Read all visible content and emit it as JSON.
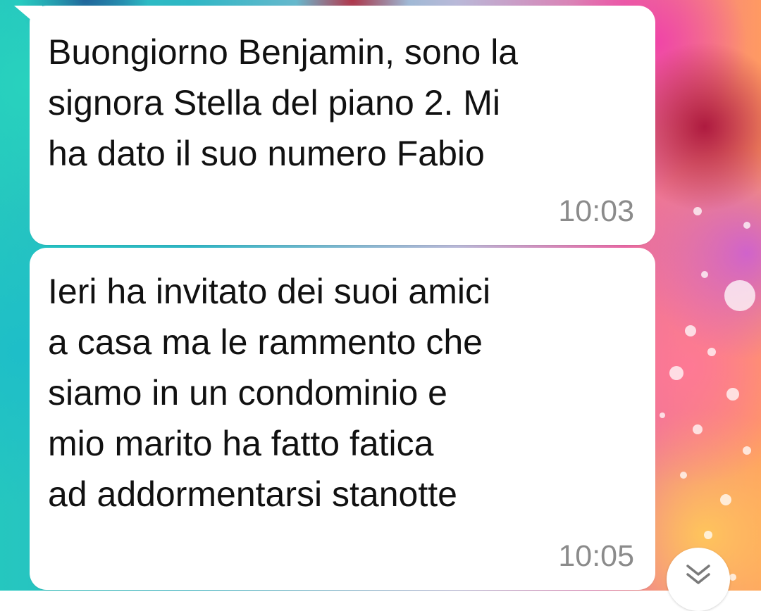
{
  "chat": {
    "messages": [
      {
        "text": "Buongiorno Benjamin, sono la\nsignora Stella del piano 2. Mi\nha dato il suo numero Fabio",
        "time": "10:03"
      },
      {
        "text": "Ieri ha invitato dei suoi amici\na casa ma le rammento che\nsiamo in un condominio e\nmio marito ha fatto fatica\nad addormentarsi stanotte",
        "time": "10:05"
      }
    ]
  },
  "controls": {
    "scroll_down_icon": "double-chevron-down-icon"
  },
  "colors": {
    "bubble_bg": "#ffffff",
    "message_text": "#111111",
    "timestamp": "#8b8b8b"
  }
}
